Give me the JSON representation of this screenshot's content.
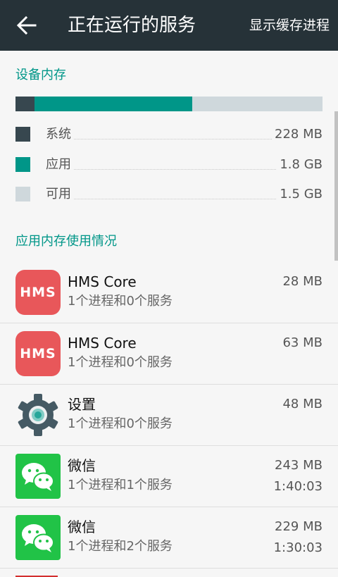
{
  "header": {
    "title": "正在运行的服务",
    "action_label": "显示缓存进程"
  },
  "memory": {
    "section_title": "设备内存",
    "usage_fractions": {
      "system": 0.062,
      "apps": 0.514,
      "free": 0.424
    },
    "legend": [
      {
        "label": "系统",
        "value": "228 MB"
      },
      {
        "label": "应用",
        "value": "1.8 GB"
      },
      {
        "label": "可用",
        "value": "1.5 GB"
      }
    ],
    "colors": {
      "system": "#37474f",
      "apps": "#009688",
      "free": "#cfd8dc"
    }
  },
  "apps": {
    "section_title": "应用内存使用情况",
    "items": [
      {
        "icon": "hms-core-icon",
        "icon_text": "HMS",
        "name": "HMS Core",
        "detail": "1个进程和0个服务",
        "memory": "28 MB"
      },
      {
        "icon": "hms-core-icon",
        "icon_text": "HMS",
        "name": "HMS Core",
        "detail": "1个进程和0个服务",
        "memory": "63 MB"
      },
      {
        "icon": "settings-gear-icon",
        "name": "设置",
        "detail": "1个进程和0个服务",
        "memory": "48 MB"
      },
      {
        "icon": "wechat-icon",
        "name": "微信",
        "detail": "1个进程和1个服务",
        "memory": "243 MB",
        "time": "1:40:03"
      },
      {
        "icon": "wechat-icon",
        "name": "微信",
        "detail": "1个进程和2个服务",
        "memory": "229 MB",
        "time": "1:30:03"
      }
    ]
  }
}
